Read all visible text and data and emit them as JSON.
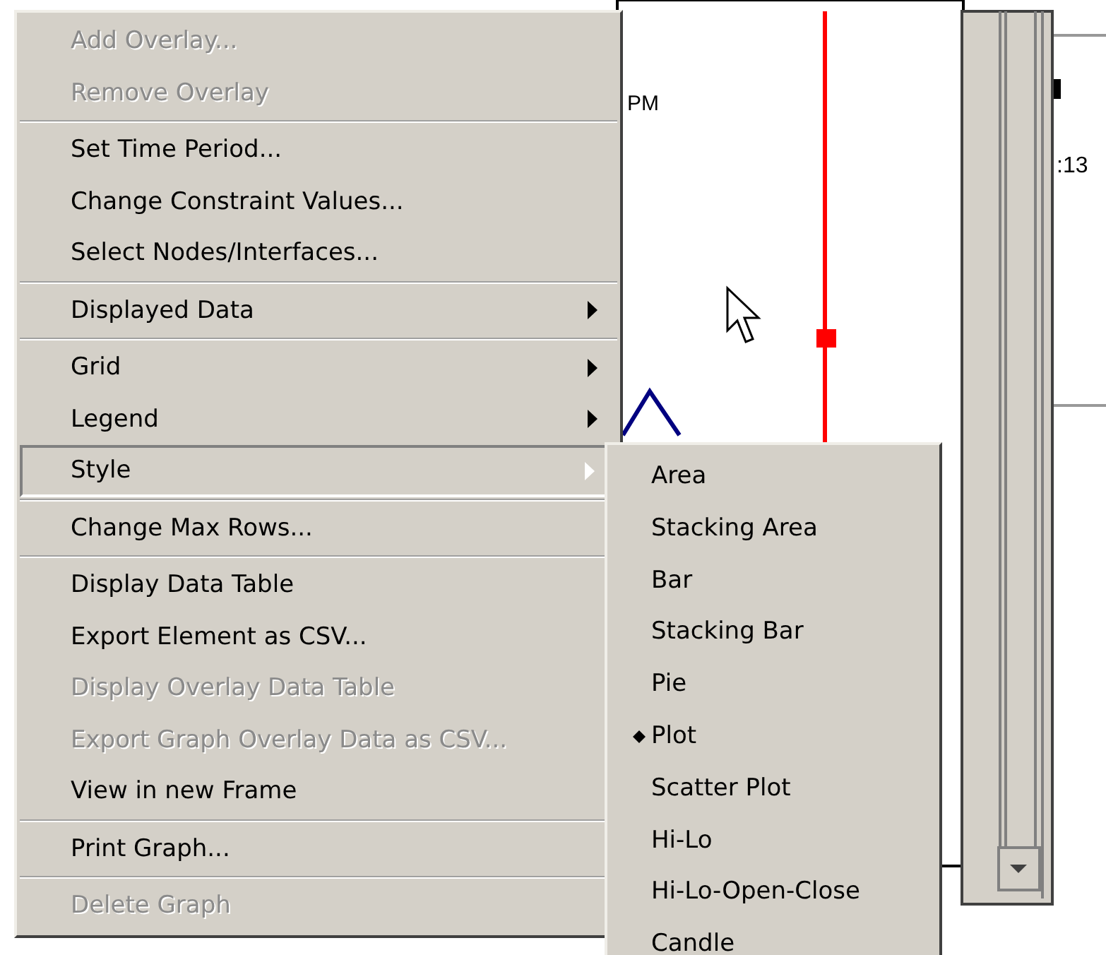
{
  "graph": {
    "time_label": "PM",
    "side_label": ":13"
  },
  "menu": {
    "items": [
      {
        "kind": "item",
        "label": "Add Overlay...",
        "disabled": true
      },
      {
        "kind": "item",
        "label": "Remove Overlay",
        "disabled": true
      },
      {
        "kind": "separator"
      },
      {
        "kind": "item",
        "label": "Set Time Period...",
        "disabled": false
      },
      {
        "kind": "item",
        "label": "Change Constraint Values...",
        "disabled": false
      },
      {
        "kind": "item",
        "label": "Select Nodes/Interfaces...",
        "disabled": false
      },
      {
        "kind": "separator"
      },
      {
        "kind": "submenu",
        "label": "Displayed Data",
        "highlighted": false
      },
      {
        "kind": "separator"
      },
      {
        "kind": "submenu",
        "label": "Grid",
        "highlighted": false
      },
      {
        "kind": "submenu",
        "label": "Legend",
        "highlighted": false
      },
      {
        "kind": "submenu",
        "label": "Style",
        "highlighted": true
      },
      {
        "kind": "separator"
      },
      {
        "kind": "item",
        "label": "Change Max Rows...",
        "disabled": false
      },
      {
        "kind": "separator"
      },
      {
        "kind": "item",
        "label": "Display Data Table",
        "disabled": false
      },
      {
        "kind": "item",
        "label": "Export Element as CSV...",
        "disabled": false
      },
      {
        "kind": "item",
        "label": "Display Overlay Data Table",
        "disabled": true
      },
      {
        "kind": "item",
        "label": "Export Graph Overlay Data as CSV...",
        "disabled": true
      },
      {
        "kind": "item",
        "label": "View in new Frame",
        "disabled": false
      },
      {
        "kind": "separator"
      },
      {
        "kind": "item",
        "label": "Print Graph...",
        "disabled": false
      },
      {
        "kind": "separator"
      },
      {
        "kind": "item",
        "label": "Delete Graph",
        "disabled": true
      }
    ]
  },
  "style_submenu": {
    "items": [
      {
        "label": "Area",
        "selected": false
      },
      {
        "label": "Stacking Area",
        "selected": false
      },
      {
        "label": "Bar",
        "selected": false
      },
      {
        "label": "Stacking Bar",
        "selected": false
      },
      {
        "label": "Pie",
        "selected": false
      },
      {
        "label": "Plot",
        "selected": true
      },
      {
        "label": "Scatter Plot",
        "selected": false
      },
      {
        "label": "Hi-Lo",
        "selected": false
      },
      {
        "label": "Hi-Lo-Open-Close",
        "selected": false
      },
      {
        "label": "Candle",
        "selected": false
      }
    ]
  }
}
